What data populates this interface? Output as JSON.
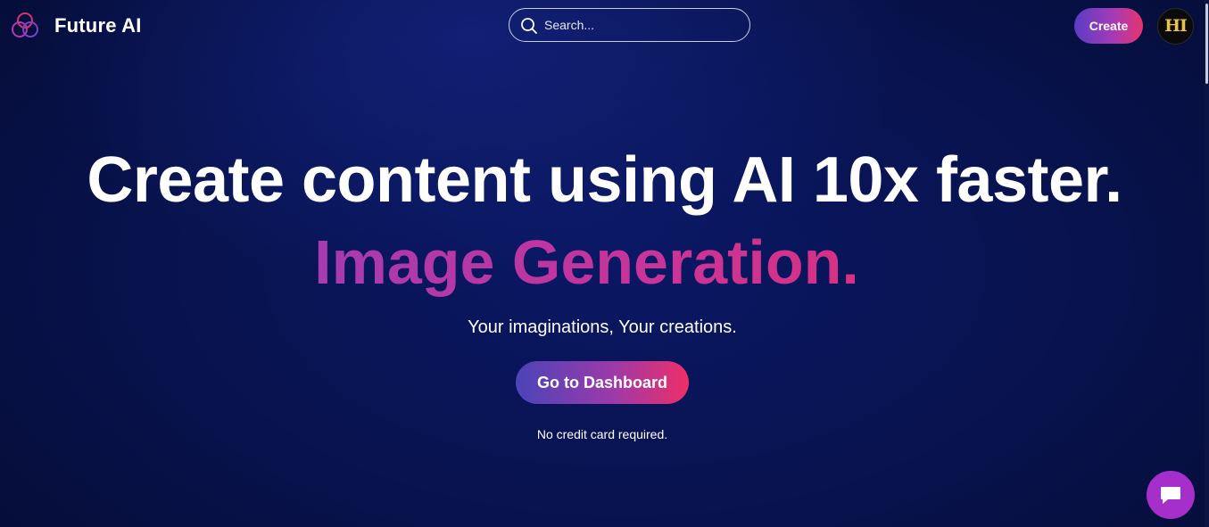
{
  "header": {
    "brand": "Future AI",
    "logo_icon": "three-rings-logo-icon",
    "search": {
      "placeholder": "Search...",
      "value": "",
      "icon": "search-icon"
    },
    "create_label": "Create",
    "avatar_text": "HI"
  },
  "hero": {
    "title": "Create content using AI 10x faster.",
    "subtitle": "Image Generation.",
    "tagline": "Your imaginations, Your creations.",
    "cta_label": "Go to Dashboard",
    "note": "No credit card required."
  },
  "chat_widget": {
    "icon": "chat-bubble-icon"
  },
  "colors": {
    "background": "#08134f",
    "accent_gradient_start": "#5b3cc4",
    "accent_gradient_mid": "#a33bb8",
    "accent_gradient_end": "#e8336e",
    "subtitle_color": "#c0379c",
    "chat_button": "#a62fcb",
    "avatar_gold": "#e9c34a"
  }
}
